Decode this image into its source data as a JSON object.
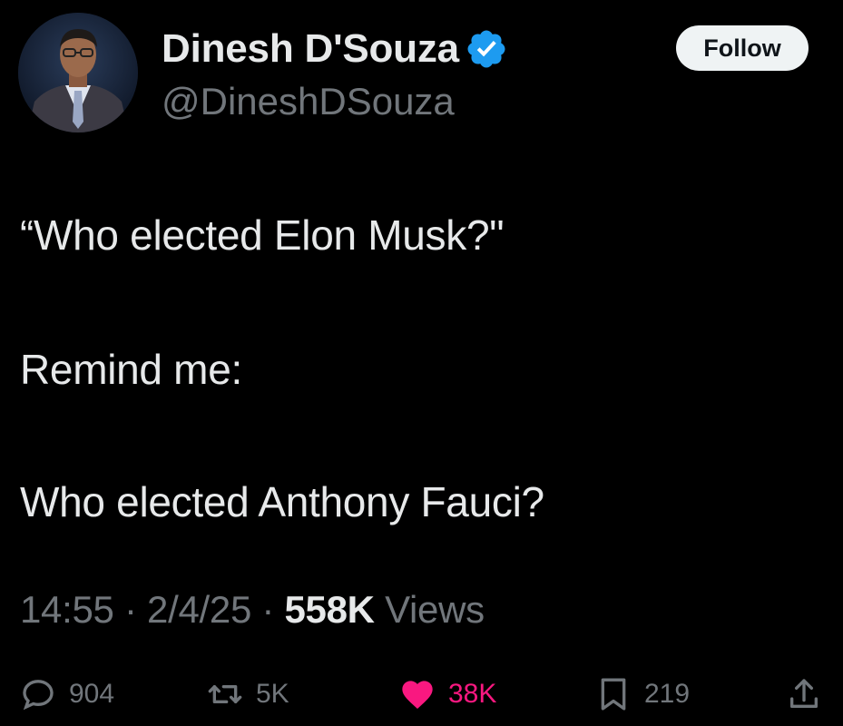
{
  "author": {
    "display_name": "Dinesh D'Souza",
    "handle": "@DineshDSouza",
    "verified": true,
    "avatar_icon": "author-avatar"
  },
  "follow_button": {
    "label": "Follow"
  },
  "tweet": {
    "lines": [
      "“Who elected Elon Musk?\"",
      "Remind me:",
      "Who elected Anthony Fauci?"
    ]
  },
  "meta": {
    "time": "14:55",
    "separator": "·",
    "date": "2/4/25",
    "views_count": "558K",
    "views_label": "Views"
  },
  "actions": {
    "reply": {
      "icon": "reply-icon",
      "count": "904"
    },
    "retweet": {
      "icon": "retweet-icon",
      "count": "5K"
    },
    "like": {
      "icon": "heart-icon",
      "count": "38K",
      "active": true
    },
    "bookmark": {
      "icon": "bookmark-icon",
      "count": "219"
    },
    "share": {
      "icon": "share-icon"
    }
  },
  "colors": {
    "background": "#000000",
    "text_primary": "#e7e9ea",
    "text_secondary": "#71767b",
    "verified_blue": "#1d9bf0",
    "like_pink": "#f91880",
    "follow_bg": "#eff3f4"
  }
}
